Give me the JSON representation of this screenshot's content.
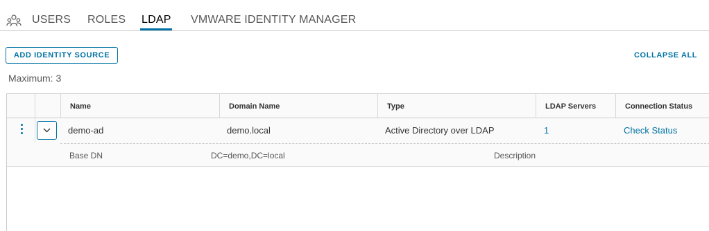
{
  "tabs": {
    "items": [
      {
        "label": "USERS"
      },
      {
        "label": "ROLES"
      },
      {
        "label": "LDAP",
        "active": true
      },
      {
        "label": "VMWARE IDENTITY MANAGER"
      }
    ],
    "icon": "users-group-icon"
  },
  "toolbar": {
    "add_label": "ADD IDENTITY SOURCE",
    "collapse_label": "COLLAPSE ALL"
  },
  "maximum_text": "Maximum: 3",
  "table": {
    "columns": [
      "Name",
      "Domain Name",
      "Type",
      "LDAP Servers",
      "Connection Status"
    ],
    "rows": [
      {
        "name": "demo-ad",
        "domain": "demo.local",
        "type": "Active Directory over LDAP",
        "ldap_servers": "1",
        "status_link": "Check Status",
        "details": {
          "base_dn_label": "Base DN",
          "base_dn_value": "DC=demo,DC=local",
          "description_label": "Description"
        }
      }
    ]
  },
  "colors": {
    "accent": "#0072a3",
    "border": "#cccccc",
    "header_bg": "#fafafa"
  }
}
